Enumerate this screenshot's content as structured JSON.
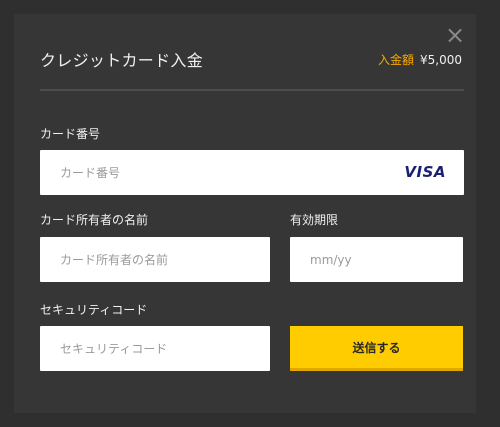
{
  "modal": {
    "title": "クレジットカード入金",
    "close_glyph": "×",
    "amount_label": "入金額",
    "amount_value": "¥5,000"
  },
  "form": {
    "card_number": {
      "label": "カード番号",
      "placeholder": "カード番号",
      "value": "",
      "brand": "VISA"
    },
    "card_holder": {
      "label": "カード所有者の名前",
      "placeholder": "カード所有者の名前",
      "value": ""
    },
    "expiry": {
      "label": "有効期限",
      "placeholder": "mm/yy",
      "value": ""
    },
    "security_code": {
      "label": "セキュリティコード",
      "placeholder": "セキュリティコード",
      "value": ""
    },
    "submit_label": "送信する"
  },
  "colors": {
    "background": "#2f2f2f",
    "modal": "#363636",
    "accent_amount": "#f5a900",
    "button": "#ffcc00",
    "visa_blue": "#1a1f71"
  },
  "icons": {
    "close": "close-icon",
    "card_brand": "visa-logo-icon"
  }
}
